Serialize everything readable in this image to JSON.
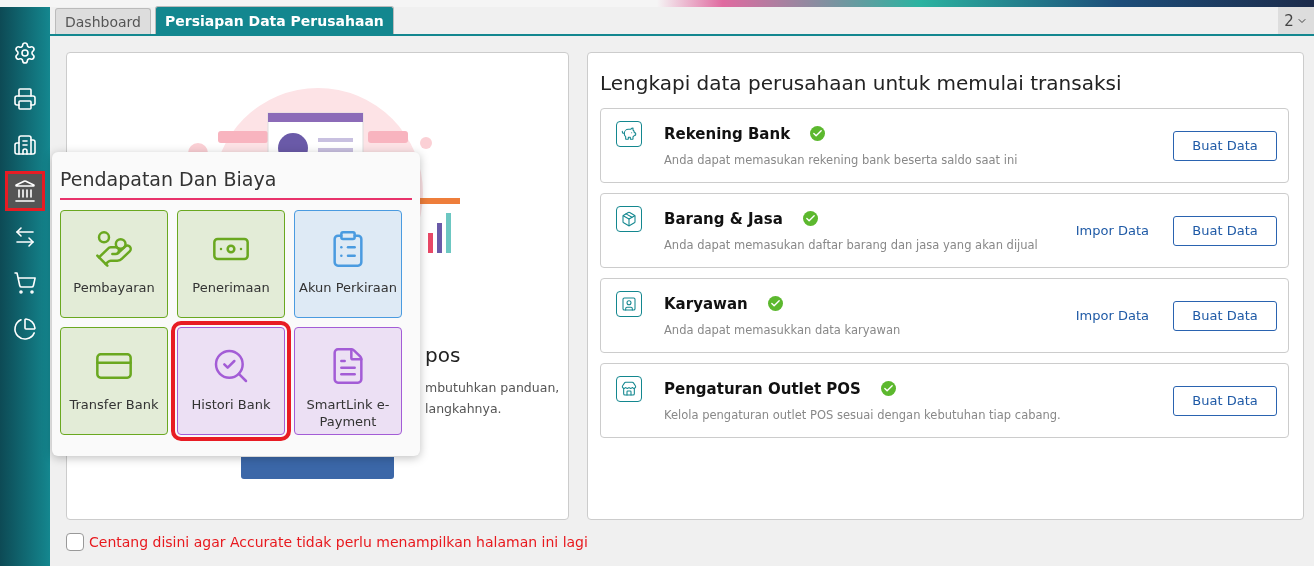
{
  "tabs": [
    {
      "label": "Dashboard",
      "selected": false
    },
    {
      "label": "Persiapan Data Perusahaan",
      "selected": true
    }
  ],
  "tab_menu": {
    "label": "2"
  },
  "sidebar": {
    "items": [
      {
        "highlighted": false
      },
      {
        "highlighted": false
      },
      {
        "highlighted": false
      },
      {
        "highlighted": true
      },
      {
        "highlighted": false
      },
      {
        "highlighted": false
      },
      {
        "highlighted": false
      }
    ]
  },
  "welcome": {
    "heading": "pos",
    "lines": [
      "mbutuhkan panduan,",
      "langkahnya."
    ]
  },
  "popup": {
    "title": "Pendapatan Dan Biaya",
    "tiles": [
      {
        "label": "Pembayaran",
        "color": "#6aa820",
        "highlighted": false
      },
      {
        "label": "Penerimaan",
        "color": "#6aa820",
        "highlighted": false
      },
      {
        "label": "Akun Perkiraan",
        "color": "#4a9be0",
        "highlighted": false
      },
      {
        "label": "Transfer Bank",
        "color": "#6aa820",
        "highlighted": false
      },
      {
        "label": "Histori Bank",
        "color": "#a35cd6",
        "highlighted": true
      },
      {
        "label": "SmartLink e-Payment",
        "color": "#a35cd6",
        "highlighted": false
      }
    ]
  },
  "setup": {
    "title": "Lengkapi data perusahaan untuk memulai transaksi",
    "rows": [
      {
        "title": "Rekening Bank",
        "done": true,
        "description": "Anda dapat memasukan rekening bank beserta saldo saat ini",
        "import_link": null,
        "button": "Buat Data"
      },
      {
        "title": "Barang & Jasa",
        "done": true,
        "description": "Anda dapat memasukan daftar barang dan jasa yang akan dijual",
        "import_link": "Impor Data",
        "button": "Buat Data"
      },
      {
        "title": "Karyawan",
        "done": true,
        "description": "Anda dapat memasukkan data karyawan",
        "import_link": "Impor Data",
        "button": "Buat Data"
      },
      {
        "title": "Pengaturan Outlet POS",
        "done": true,
        "description": "Kelola pengaturan outlet POS sesuai dengan kebutuhan tiap cabang.",
        "import_link": null,
        "button": "Buat Data"
      }
    ]
  },
  "footer": {
    "checkbox_label": "Centang disini agar Accurate tidak perlu menampilkan halaman ini lagi",
    "checked": false
  }
}
